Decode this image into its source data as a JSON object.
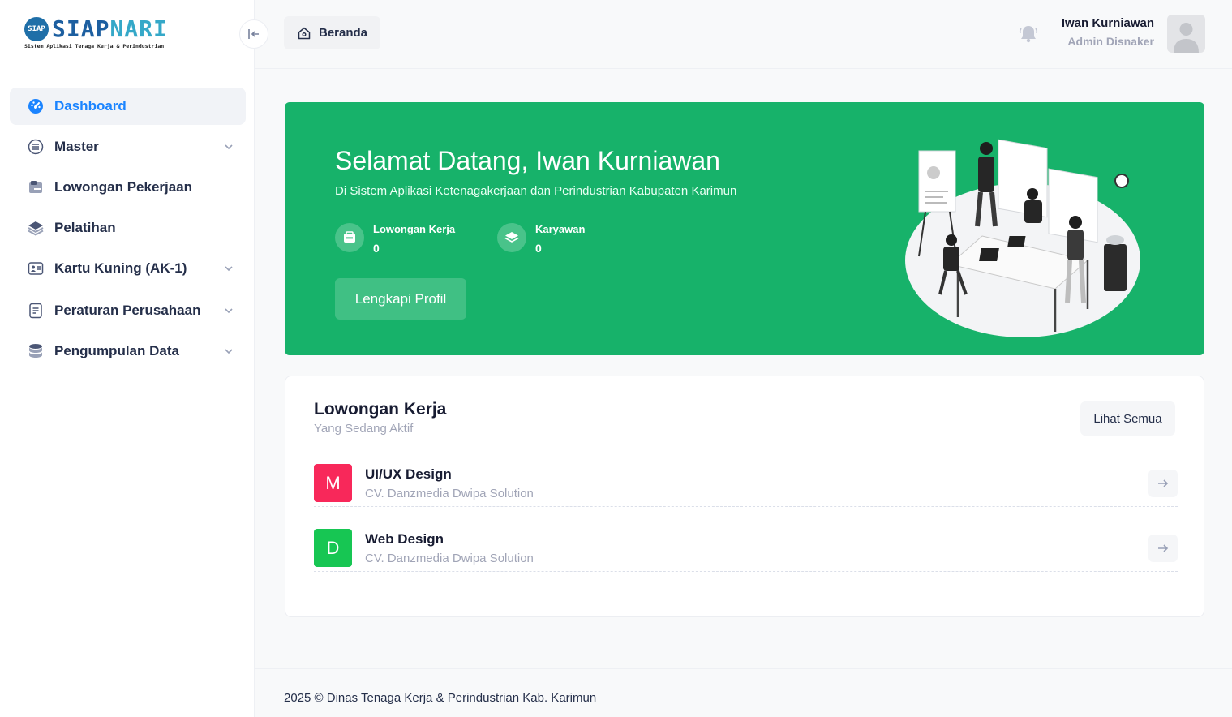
{
  "brand": {
    "logo_part1": "SIAP",
    "logo_part2": "NARI",
    "badge": "SIAP",
    "tagline": "Sistem Aplikasi Tenaga Kerja & Perindustrian"
  },
  "sidebar": {
    "items": [
      {
        "label": "Dashboard",
        "icon": "dashboard-icon",
        "active": true
      },
      {
        "label": "Master",
        "icon": "list-icon",
        "dropdown": true
      },
      {
        "label": "Lowongan Pekerjaan",
        "icon": "briefcase-icon"
      },
      {
        "label": "Pelatihan",
        "icon": "layers-icon"
      },
      {
        "label": "Kartu Kuning (AK-1)",
        "icon": "id-card-icon",
        "dropdown": true
      },
      {
        "label": "Peraturan Perusahaan",
        "icon": "document-icon",
        "dropdown": true
      },
      {
        "label": "Pengumpulan Data",
        "icon": "database-icon",
        "dropdown": true
      }
    ]
  },
  "header": {
    "breadcrumb": "Beranda",
    "user_name": "Iwan Kurniawan",
    "user_role": "Admin Disnaker"
  },
  "hero": {
    "title": "Selamat Datang, Iwan Kurniawan",
    "subtitle": "Di Sistem Aplikasi Ketenagakerjaan dan Perindustrian Kabupaten Karimun",
    "stats": [
      {
        "label": "Lowongan Kerja",
        "value": "0"
      },
      {
        "label": "Karyawan",
        "value": "0"
      }
    ],
    "button": "Lengkapi Profil",
    "color": "#17b26a"
  },
  "jobs_card": {
    "title": "Lowongan Kerja",
    "subtitle": "Yang Sedang Aktif",
    "see_all": "Lihat Semua",
    "items": [
      {
        "letter": "M",
        "title": "UI/UX Design",
        "company": "CV. Danzmedia Dwipa Solution",
        "color": "#f8285a"
      },
      {
        "letter": "D",
        "title": "Web Design",
        "company": "CV. Danzmedia Dwipa Solution",
        "color": "#17c653"
      }
    ]
  },
  "footer": {
    "text": "2025 © Dinas Tenaga Kerja & Perindustrian Kab. Karimun"
  }
}
